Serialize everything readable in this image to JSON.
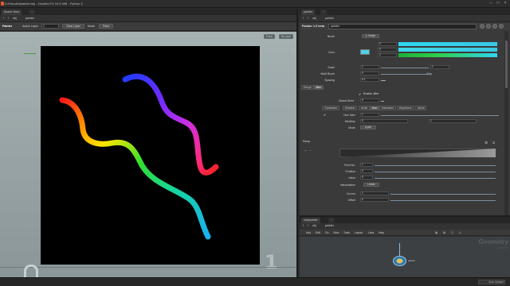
{
  "window": {
    "title": "D:/Houdini/painter.hip - Houdini FX 19.0.498 - Python 3"
  },
  "left_pane": {
    "tabs": [
      "Scene View",
      "+"
    ],
    "path": {
      "context": "obj",
      "node": "painter"
    },
    "toolbar": {
      "name": "Painter",
      "active_layer_label": "Active Layer",
      "active_layer_value": "1",
      "clear_layer": "Clear Layer",
      "mode_label": "Mode",
      "mode_value": "Paint"
    },
    "viewport": {
      "front_button": "Front",
      "no_cam_button": "No cam",
      "frame_number": "1"
    }
  },
  "right_pane": {
    "tabs": [
      "painter",
      "+"
    ],
    "path": {
      "context": "obj",
      "node": "painter"
    },
    "header": {
      "node_type": "Painter 1.0 beta",
      "node_name": "painter"
    },
    "params": {
      "brush_label": "Brush",
      "brush_value": "1: Brush",
      "color_label": "Color",
      "color_channels": [
        "0",
        "0",
        "1"
      ],
      "color_swatch": "#4dd0e8",
      "ramp_colors": [
        "#2fd6f0",
        "#38c8e6",
        "#29cf4a"
      ],
      "scale_label": "Scale",
      "scale_value": "1",
      "multi_brush_label": "Multi Brush",
      "multi_brush_value": "0",
      "spacing_label": "Spacing",
      "spacing_value": "0.1",
      "gap_label": "Gap",
      "tabs_top": [
        "Range",
        "Jitter"
      ],
      "enable_jitter": "Enable Jitter",
      "global_seed_label": "Global Seed",
      "global_seed_value": "0",
      "jitter_tabs": [
        "Translation",
        "Rotation",
        "Scale",
        "Hue",
        "Saturation",
        "Brightness",
        "Alpha"
      ],
      "hue_jitter_label": "Hue Jitter",
      "hue_jitter_value": "1",
      "min_max_label": "Min/Max",
      "min_max_values": [
        "0",
        "1"
      ],
      "mode_label": "Mode",
      "mode_value": "Cycle",
      "ramp_label": "Ramp",
      "point_no_label": "Point No.",
      "point_no_value": "1",
      "position_label": "Position",
      "position_value": "0",
      "value_label": "Value",
      "value_value": "0",
      "interpolation_label": "Interpolation",
      "interpolation_value": "Linear",
      "curves_label": "Curves",
      "curves_value": "1",
      "offset_label": "Offset",
      "offset_value": "0"
    }
  },
  "network": {
    "tabs": [
      "/obj/painter",
      "+"
    ],
    "path": {
      "context": "obj",
      "node": "painter"
    },
    "menu": [
      "Add",
      "Edit",
      "Go",
      "View",
      "Tools",
      "Layout",
      "Labs",
      "Help"
    ],
    "context_title": "Geometry",
    "node_name": "painter",
    "node_label": "painter"
  },
  "status": {
    "text": "Auto Update"
  }
}
